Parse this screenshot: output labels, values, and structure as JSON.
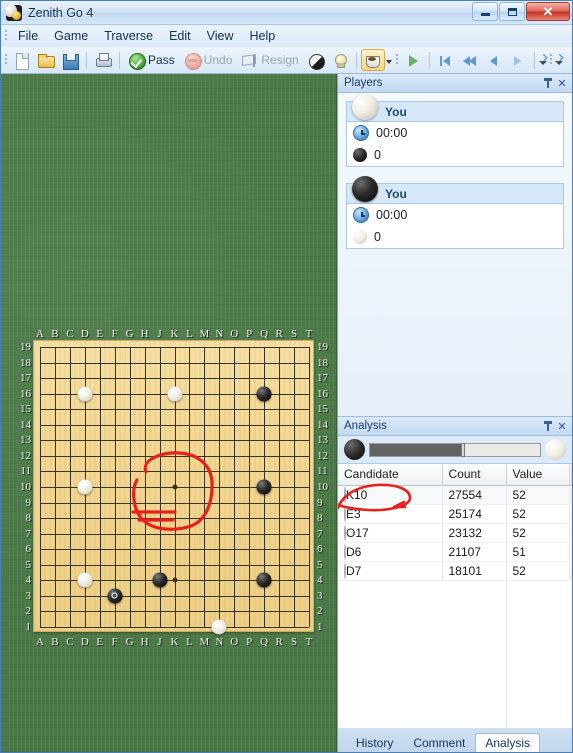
{
  "window": {
    "title": "Zenith Go 4",
    "app_icon": "go-stones-icon",
    "minimize_label": "Minimize",
    "maximize_label": "Maximize",
    "close_label": "✕"
  },
  "menubar": {
    "items": [
      {
        "label": "File"
      },
      {
        "label": "Game"
      },
      {
        "label": "Traverse"
      },
      {
        "label": "Edit"
      },
      {
        "label": "View"
      },
      {
        "label": "Help"
      }
    ]
  },
  "toolbar": {
    "new_label": "",
    "open_label": "",
    "save_label": "",
    "print_label": "",
    "pass_label": "Pass",
    "undo_label": "Undo",
    "resign_label": "Resign",
    "stone_label": "",
    "hint_label": "",
    "coffee_label": ""
  },
  "board": {
    "size": 19,
    "col_labels": [
      "A",
      "B",
      "C",
      "D",
      "E",
      "F",
      "G",
      "H",
      "J",
      "K",
      "L",
      "M",
      "N",
      "O",
      "P",
      "Q",
      "R",
      "S",
      "T"
    ],
    "row_labels": [
      "19",
      "18",
      "17",
      "16",
      "15",
      "14",
      "13",
      "12",
      "11",
      "10",
      "9",
      "8",
      "7",
      "6",
      "5",
      "4",
      "3",
      "2",
      "1"
    ],
    "hoshi": [
      "D16",
      "K16",
      "Q16",
      "D10",
      "K10",
      "Q10",
      "D4",
      "K4",
      "Q4"
    ],
    "stones": [
      {
        "coord": "D16",
        "color": "white",
        "marked": false
      },
      {
        "coord": "K16",
        "color": "white",
        "marked": false
      },
      {
        "coord": "Q16",
        "color": "black",
        "marked": false
      },
      {
        "coord": "D10",
        "color": "white",
        "marked": false
      },
      {
        "coord": "Q10",
        "color": "black",
        "marked": false
      },
      {
        "coord": "D4",
        "color": "white",
        "marked": false
      },
      {
        "coord": "F3",
        "color": "black",
        "marked": true
      },
      {
        "coord": "J4",
        "color": "black",
        "marked": false
      },
      {
        "coord": "Q4",
        "color": "black",
        "marked": false
      },
      {
        "coord": "N1",
        "color": "white",
        "marked": false
      }
    ],
    "annotation": {
      "type": "red-circle-with-arrow",
      "target": "K10",
      "color": "#e8201c"
    }
  },
  "players_panel": {
    "title": "Players",
    "pin_label": "Auto Hide",
    "close_label": "✕",
    "players": [
      {
        "stone": "white",
        "name": "You",
        "clock": "00:00",
        "captures": "0",
        "captured_stone": "black"
      },
      {
        "stone": "black",
        "name": "You",
        "clock": "00:00",
        "captures": "0",
        "captured_stone": "white"
      }
    ]
  },
  "analysis_panel": {
    "title": "Analysis",
    "pin_label": "Auto Hide",
    "close_label": "✕",
    "winrate": {
      "black_pct": 55,
      "left_stone": "black",
      "right_stone": "white"
    },
    "columns": [
      "Candidate",
      "Count",
      "Value"
    ],
    "rows": [
      {
        "candidate": "K10",
        "count": "27554",
        "value": "52",
        "highlight": true
      },
      {
        "candidate": "E3",
        "count": "25174",
        "value": "52",
        "highlight": false
      },
      {
        "candidate": "O17",
        "count": "23132",
        "value": "52",
        "highlight": false
      },
      {
        "candidate": "D6",
        "count": "21107",
        "value": "51",
        "highlight": false
      },
      {
        "candidate": "D7",
        "count": "18101",
        "value": "52",
        "highlight": false
      }
    ],
    "annotation": {
      "type": "red-circle",
      "target": "K10",
      "color": "#e8201c"
    }
  },
  "tabs": {
    "items": [
      {
        "label": "History",
        "selected": false
      },
      {
        "label": "Comment",
        "selected": false
      },
      {
        "label": "Analysis",
        "selected": true
      }
    ]
  },
  "colors": {
    "board_wood": "#f0d68f",
    "table_felt": "#4c7a48",
    "annotation_red": "#e8201c",
    "accent_blue": "#1d4a78"
  }
}
